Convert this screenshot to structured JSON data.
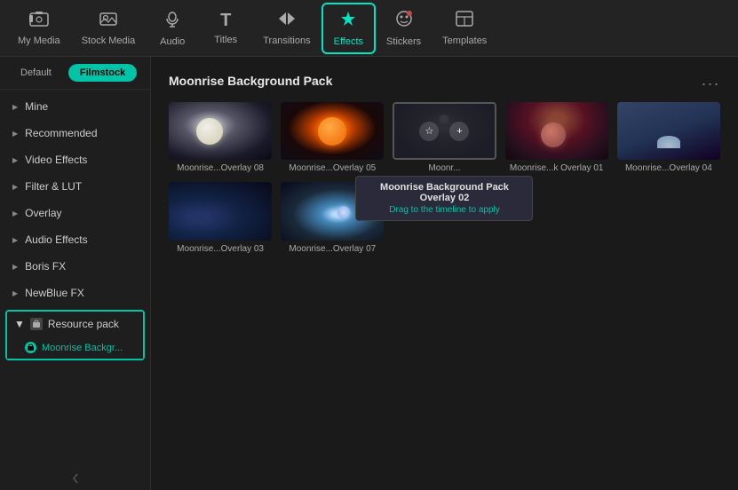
{
  "nav": {
    "items": [
      {
        "id": "my-media",
        "label": "My Media",
        "icon": "🎞"
      },
      {
        "id": "stock-media",
        "label": "Stock Media",
        "icon": "📷"
      },
      {
        "id": "audio",
        "label": "Audio",
        "icon": "🎵"
      },
      {
        "id": "titles",
        "label": "Titles",
        "icon": "T"
      },
      {
        "id": "transitions",
        "label": "Transitions",
        "icon": "➡"
      },
      {
        "id": "effects",
        "label": "Effects",
        "icon": "✦"
      },
      {
        "id": "stickers",
        "label": "Stickers",
        "icon": "🔴"
      },
      {
        "id": "templates",
        "label": "Templates",
        "icon": "▦"
      }
    ]
  },
  "filters": {
    "tabs": [
      {
        "id": "default",
        "label": "Default"
      },
      {
        "id": "filmstock",
        "label": "Filmstock"
      }
    ]
  },
  "sidebar": {
    "items": [
      {
        "id": "mine",
        "label": "Mine"
      },
      {
        "id": "recommended",
        "label": "Recommended"
      },
      {
        "id": "video-effects",
        "label": "Video Effects"
      },
      {
        "id": "filter-lut",
        "label": "Filter & LUT"
      },
      {
        "id": "overlay",
        "label": "Overlay"
      },
      {
        "id": "audio-effects",
        "label": "Audio Effects"
      },
      {
        "id": "boris-fx",
        "label": "Boris FX"
      },
      {
        "id": "newblue-fx",
        "label": "NewBlue FX"
      }
    ],
    "resource_pack": {
      "label": "Resource pack",
      "sub_item": "Moonrise Backgr..."
    }
  },
  "content": {
    "title": "Moonrise Background Pack",
    "more_label": "...",
    "effects": [
      {
        "id": "overlay-08",
        "label": "Moonrise...Overlay 08",
        "thumb": "thumb-08"
      },
      {
        "id": "overlay-05",
        "label": "Moonrise...Overlay 05",
        "thumb": "thumb-05"
      },
      {
        "id": "overlay-02",
        "label": "Moonrise...Overlay 02",
        "thumb": "thumb-02",
        "has_tooltip": true
      },
      {
        "id": "overlay-01",
        "label": "Moonrise...k Overlay 01",
        "thumb": "thumb-01"
      },
      {
        "id": "overlay-04",
        "label": "Moonrise...Overlay 04",
        "thumb": "thumb-04"
      },
      {
        "id": "overlay-03",
        "label": "Moonrise...Overlay 03",
        "thumb": "thumb-03"
      },
      {
        "id": "overlay-07",
        "label": "Moonrise...Overlay 07",
        "thumb": "thumb-07"
      }
    ],
    "tooltip": {
      "title": "Moonrise Background Pack Overlay 02",
      "subtitle": "Drag to the timeline to apply"
    }
  }
}
